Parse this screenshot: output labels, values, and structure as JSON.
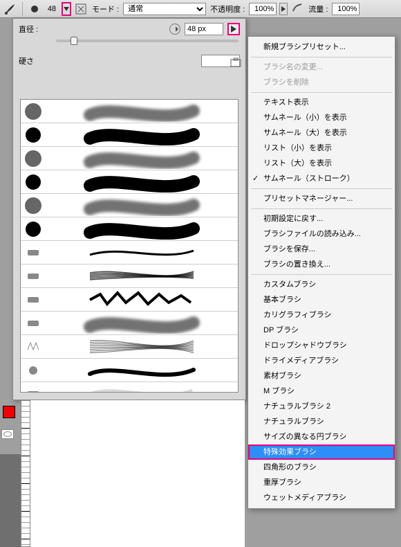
{
  "toolbar": {
    "brush_size": "48",
    "mode_label": "モード :",
    "mode_value": "通常",
    "opacity_label": "不透明度 :",
    "opacity_value": "100%",
    "flow_label": "流量 :",
    "flow_value": "100%"
  },
  "panel": {
    "diameter_label": "直径 :",
    "diameter_value": "48 px",
    "hardness_label": "硬さ"
  },
  "menu": {
    "items": [
      {
        "label": "新規ブラシプリセット...",
        "type": "item"
      },
      {
        "type": "sep"
      },
      {
        "label": "ブラシ名の変更...",
        "type": "disabled"
      },
      {
        "label": "ブラシを削除",
        "type": "disabled"
      },
      {
        "type": "sep"
      },
      {
        "label": "テキスト表示",
        "type": "item"
      },
      {
        "label": "サムネール（小）を表示",
        "type": "item"
      },
      {
        "label": "サムネール（大）を表示",
        "type": "item"
      },
      {
        "label": "リスト（小）を表示",
        "type": "item"
      },
      {
        "label": "リスト（大）を表示",
        "type": "item"
      },
      {
        "label": "サムネール（ストローク）",
        "type": "checked"
      },
      {
        "type": "sep"
      },
      {
        "label": "プリセットマネージャー...",
        "type": "item"
      },
      {
        "type": "sep"
      },
      {
        "label": "初期設定に戻す...",
        "type": "item"
      },
      {
        "label": "ブラシファイルの読み込み...",
        "type": "item"
      },
      {
        "label": "ブラシを保存...",
        "type": "item"
      },
      {
        "label": "ブラシの置き換え...",
        "type": "item"
      },
      {
        "type": "sep"
      },
      {
        "label": "カスタムブラシ",
        "type": "item"
      },
      {
        "label": "基本ブラシ",
        "type": "item"
      },
      {
        "label": "カリグラフィブラシ",
        "type": "item"
      },
      {
        "label": "DP ブラシ",
        "type": "item"
      },
      {
        "label": "ドロップシャドウブラシ",
        "type": "item"
      },
      {
        "label": "ドライメディアブラシ",
        "type": "item"
      },
      {
        "label": "素材ブラシ",
        "type": "item"
      },
      {
        "label": "M ブラシ",
        "type": "item"
      },
      {
        "label": "ナチュラルブラシ 2",
        "type": "item"
      },
      {
        "label": "ナチュラルブラシ",
        "type": "item"
      },
      {
        "label": "サイズの異なる円ブラシ",
        "type": "item"
      },
      {
        "label": "特殊効果ブラシ",
        "type": "highlight"
      },
      {
        "label": "四角形のブラシ",
        "type": "item"
      },
      {
        "label": "重厚ブラシ",
        "type": "item"
      },
      {
        "label": "ウェットメディアブラシ",
        "type": "item"
      }
    ]
  },
  "brush_strokes": [
    {
      "tip": "soft-round",
      "stroke": "soft"
    },
    {
      "tip": "hard-round",
      "stroke": "hard"
    },
    {
      "tip": "soft-round",
      "stroke": "soft"
    },
    {
      "tip": "hard-round",
      "stroke": "hard"
    },
    {
      "tip": "soft-round",
      "stroke": "soft"
    },
    {
      "tip": "hard-round",
      "stroke": "hard"
    },
    {
      "tip": "flat",
      "stroke": "thin"
    },
    {
      "tip": "flat",
      "stroke": "bristle"
    },
    {
      "tip": "flat",
      "stroke": "scribble"
    },
    {
      "tip": "flat",
      "stroke": "soft"
    },
    {
      "tip": "fan",
      "stroke": "multi"
    },
    {
      "tip": "round",
      "stroke": "wave"
    },
    {
      "tip": "flat",
      "stroke": "faint"
    }
  ]
}
